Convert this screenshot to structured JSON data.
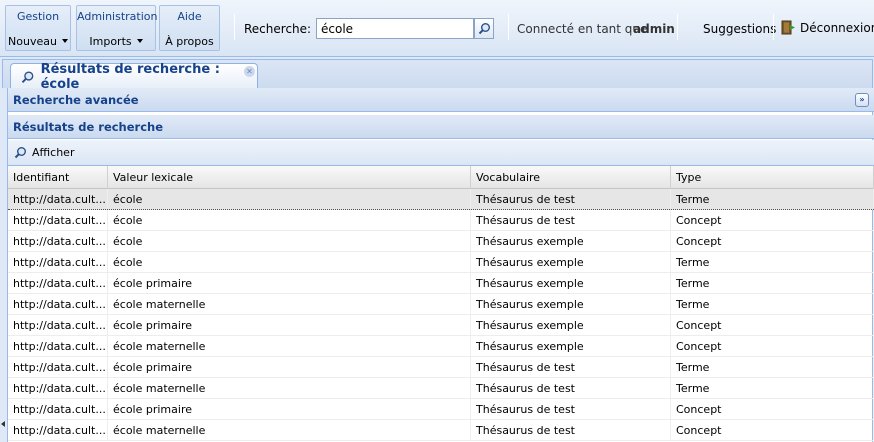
{
  "menus": [
    {
      "title": "Gestion",
      "button": "Nouveau"
    },
    {
      "title": "Administration",
      "button": "Imports"
    },
    {
      "title": "Aide",
      "button": "À propos"
    }
  ],
  "search": {
    "label": "Recherche:",
    "value": "école"
  },
  "user": {
    "connected_label": "Connecté en tant que",
    "name": "admin"
  },
  "links": {
    "suggestions": "Suggestions",
    "logout": "Déconnexion"
  },
  "tab": {
    "label": "Résultats de recherche : école"
  },
  "panels": {
    "advanced": "Recherche avancée",
    "results": "Résultats de recherche"
  },
  "toolbar": {
    "show_label": "Afficher"
  },
  "grid": {
    "columns": [
      "Identifiant",
      "Valeur lexicale",
      "Vocabulaire",
      "Type"
    ],
    "rows": [
      [
        "http://data.cult...",
        "école",
        "Thésaurus de test",
        "Terme"
      ],
      [
        "http://data.cult...",
        "école",
        "Thésaurus de test",
        "Concept"
      ],
      [
        "http://data.cult...",
        "école",
        "Thésaurus exemple",
        "Concept"
      ],
      [
        "http://data.cult...",
        "école",
        "Thésaurus exemple",
        "Terme"
      ],
      [
        "http://data.cult...",
        "école primaire",
        "Thésaurus exemple",
        "Terme"
      ],
      [
        "http://data.cult...",
        "école maternelle",
        "Thésaurus exemple",
        "Terme"
      ],
      [
        "http://data.cult...",
        "école primaire",
        "Thésaurus exemple",
        "Concept"
      ],
      [
        "http://data.cult...",
        "école maternelle",
        "Thésaurus exemple",
        "Concept"
      ],
      [
        "http://data.cult...",
        "école primaire",
        "Thésaurus de test",
        "Terme"
      ],
      [
        "http://data.cult...",
        "école maternelle",
        "Thésaurus de test",
        "Terme"
      ],
      [
        "http://data.cult...",
        "école primaire",
        "Thésaurus de test",
        "Concept"
      ],
      [
        "http://data.cult...",
        "école maternelle",
        "Thésaurus de test",
        "Concept"
      ]
    ]
  },
  "colors": {
    "header_text": "#15428b",
    "border": "#99bbe8",
    "selected_row": "#e6e6e6"
  }
}
